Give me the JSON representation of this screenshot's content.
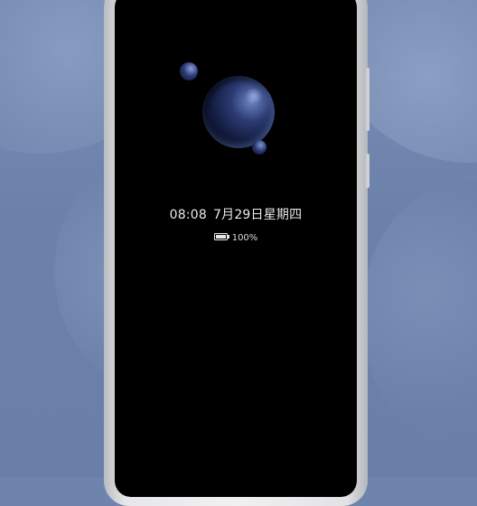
{
  "lock_screen": {
    "time": "08:08",
    "date": "7月29日星期四",
    "battery": {
      "percent_text": "100%",
      "level": 1.0
    }
  },
  "colors": {
    "screen_bg": "#000000",
    "wallpaper": "#6f84ad",
    "text": "#e9e9e9"
  },
  "icons": [
    "bubble-graphic",
    "battery-icon"
  ]
}
